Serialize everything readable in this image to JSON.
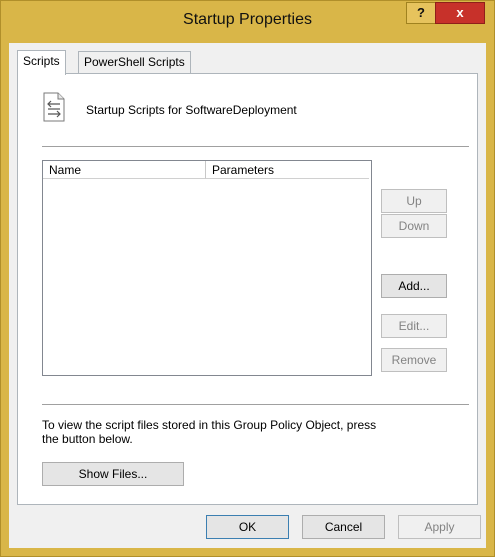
{
  "window": {
    "title": "Startup Properties",
    "help_label": "?",
    "close_label": "x"
  },
  "tabs": [
    {
      "label": "Scripts"
    },
    {
      "label": "PowerShell Scripts"
    }
  ],
  "header": {
    "icon": "script-document-icon",
    "text": "Startup Scripts for SoftwareDeployment"
  },
  "list": {
    "columns": [
      "Name",
      "Parameters"
    ],
    "rows": []
  },
  "side_buttons": {
    "up": "Up",
    "down": "Down",
    "add": "Add...",
    "edit": "Edit...",
    "remove": "Remove"
  },
  "description": {
    "line1": "To view the script files stored in this Group Policy Object, press",
    "line2": "the button below."
  },
  "show_files_label": "Show Files...",
  "footer": {
    "ok": "OK",
    "cancel": "Cancel",
    "apply": "Apply"
  },
  "colors": {
    "titlebar": "#d9b648",
    "close": "#c7312a",
    "client": "#f0f0f0",
    "default_border": "#3c7fb1"
  }
}
